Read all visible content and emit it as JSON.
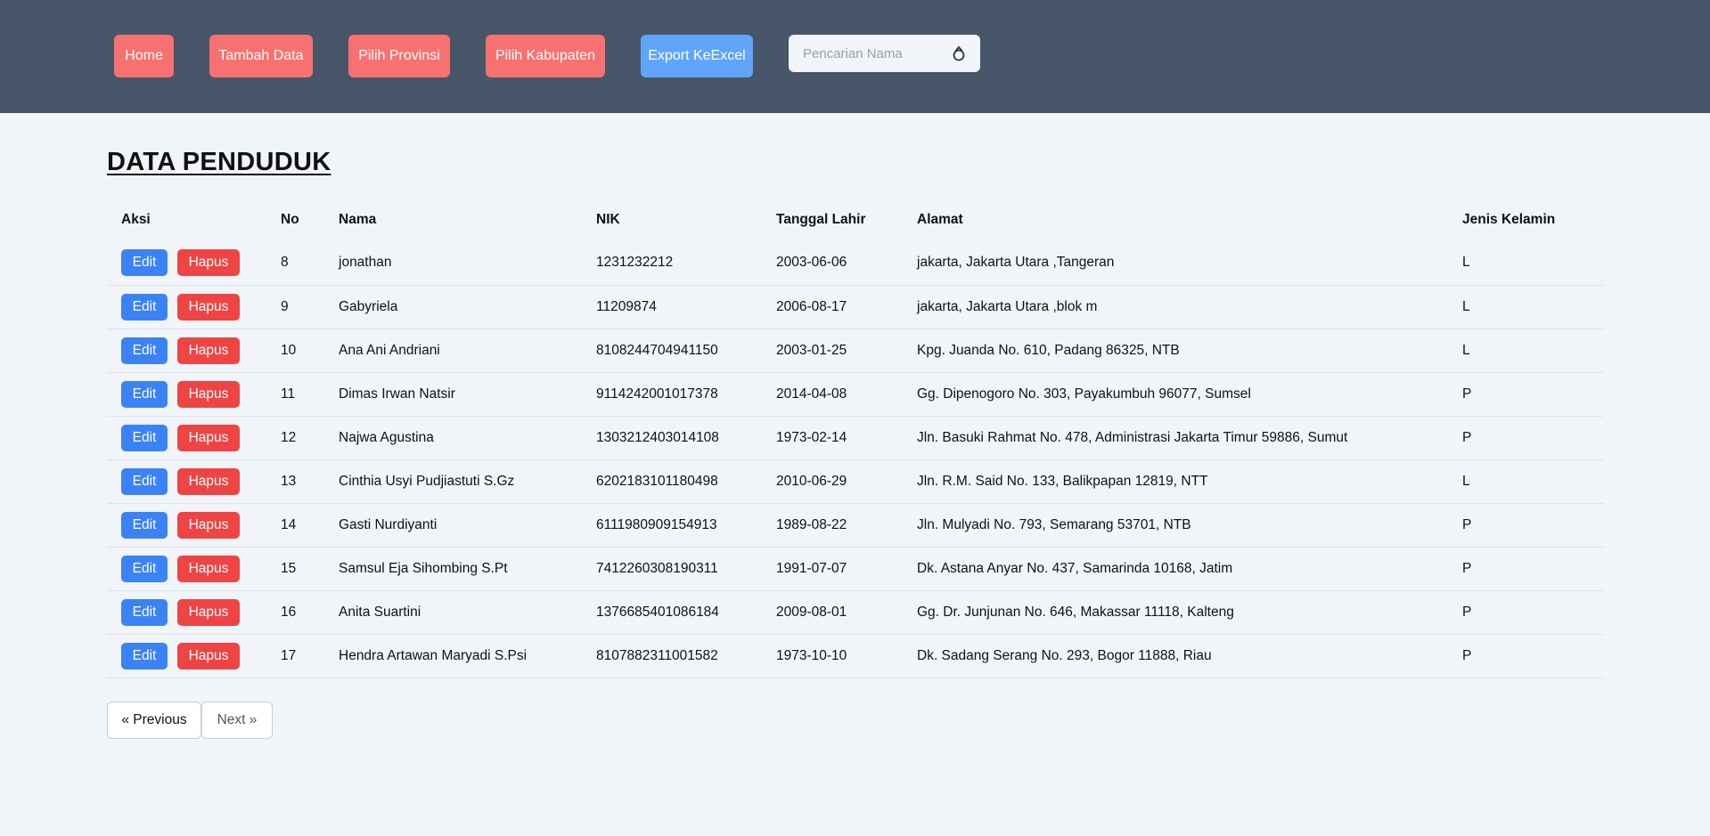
{
  "nav": {
    "home": "Home",
    "tambah": "Tambah Data",
    "provinsi": "Pilih Provinsi",
    "kabupaten": "Pilih Kabupaten",
    "export": "Export KeExcel",
    "search_placeholder": "Pencarian Nama",
    "search_value": "",
    "search_icon": "search-icon"
  },
  "page": {
    "title": "DATA PENDUDUK"
  },
  "table": {
    "headers": {
      "aksi": "Aksi",
      "no": "No",
      "nama": "Nama",
      "nik": "NIK",
      "tgl": "Tanggal Lahir",
      "alamat": "Alamat",
      "jk": "Jenis Kelamin"
    },
    "edit_label": "Edit",
    "hapus_label": "Hapus",
    "rows": [
      {
        "no": "8",
        "nama": "jonathan",
        "nik": "1231232212",
        "tgl": "2003-06-06",
        "alamat": "jakarta, Jakarta Utara ,Tangeran",
        "jk": "L"
      },
      {
        "no": "9",
        "nama": "Gabyriela",
        "nik": "11209874",
        "tgl": "2006-08-17",
        "alamat": "jakarta, Jakarta Utara ,blok m",
        "jk": "L"
      },
      {
        "no": "10",
        "nama": "Ana Ani Andriani",
        "nik": "8108244704941150",
        "tgl": "2003-01-25",
        "alamat": "Kpg. Juanda No. 610, Padang 86325, NTB",
        "jk": "L"
      },
      {
        "no": "11",
        "nama": "Dimas Irwan Natsir",
        "nik": "9114242001017378",
        "tgl": "2014-04-08",
        "alamat": "Gg. Dipenogoro No. 303, Payakumbuh 96077, Sumsel",
        "jk": "P"
      },
      {
        "no": "12",
        "nama": "Najwa Agustina",
        "nik": "1303212403014108",
        "tgl": "1973-02-14",
        "alamat": "Jln. Basuki Rahmat No. 478, Administrasi Jakarta Timur 59886, Sumut",
        "jk": "P"
      },
      {
        "no": "13",
        "nama": "Cinthia Usyi Pudjiastuti S.Gz",
        "nik": "6202183101180498",
        "tgl": "2010-06-29",
        "alamat": "Jln. R.M. Said No. 133, Balikpapan 12819, NTT",
        "jk": "L"
      },
      {
        "no": "14",
        "nama": "Gasti Nurdiyanti",
        "nik": "6111980909154913",
        "tgl": "1989-08-22",
        "alamat": "Jln. Mulyadi No. 793, Semarang 53701, NTB",
        "jk": "P"
      },
      {
        "no": "15",
        "nama": "Samsul Eja Sihombing S.Pt",
        "nik": "7412260308190311",
        "tgl": "1991-07-07",
        "alamat": "Dk. Astana Anyar No. 437, Samarinda 10168, Jatim",
        "jk": "P"
      },
      {
        "no": "16",
        "nama": "Anita Suartini",
        "nik": "1376685401086184",
        "tgl": "2009-08-01",
        "alamat": "Gg. Dr. Junjunan No. 646, Makassar 11118, Kalteng",
        "jk": "P"
      },
      {
        "no": "17",
        "nama": "Hendra Artawan Maryadi S.Psi",
        "nik": "8107882311001582",
        "tgl": "1973-10-10",
        "alamat": "Dk. Sadang Serang No. 293, Bogor 11888, Riau",
        "jk": "P"
      }
    ]
  },
  "pager": {
    "prev": "« Previous",
    "next": "Next »"
  },
  "colors": {
    "topbar": "#475569",
    "nav_button": "#f87171",
    "export_button": "#60a5fa",
    "edit_button": "#3b82f6",
    "hapus_button": "#ef4444",
    "background": "#f1f4f8"
  }
}
